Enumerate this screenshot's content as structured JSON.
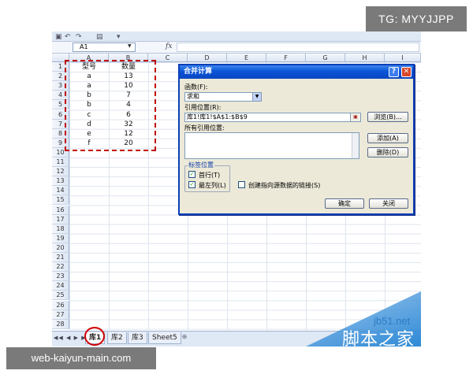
{
  "overlays": {
    "tg": "TG: MYYJJPP",
    "web": "web-kaiyun-main.com"
  },
  "excel": {
    "name_box": "A1",
    "fx": "fx",
    "columns": [
      "A",
      "B",
      "C",
      "D",
      "E",
      "F",
      "G",
      "H",
      "I"
    ],
    "rows": [
      "1",
      "2",
      "3",
      "4",
      "5",
      "6",
      "7",
      "8",
      "9",
      "10",
      "11",
      "12",
      "13",
      "14",
      "15",
      "16",
      "17",
      "18",
      "19",
      "20",
      "21",
      "22",
      "23",
      "24",
      "25",
      "26",
      "27",
      "28"
    ],
    "data": [
      [
        "型号",
        "数量"
      ],
      [
        "a",
        "13"
      ],
      [
        "a",
        "10"
      ],
      [
        "b",
        "7"
      ],
      [
        "b",
        "4"
      ],
      [
        "c",
        "6"
      ],
      [
        "d",
        "32"
      ],
      [
        "e",
        "12"
      ],
      [
        "f",
        "20"
      ]
    ],
    "sheet_tabs": [
      "库1",
      "库2",
      "库3",
      "Sheet5"
    ],
    "active_tab": "库1",
    "tab_nav": "◀◀ ◀ ▶ ▶▶"
  },
  "dialog": {
    "title": "合并计算",
    "help": "?",
    "close": "✕",
    "function_label": "函数(F):",
    "function_value": "求和",
    "reference_label": "引用位置(R):",
    "reference_value": "库1!库1!$A$1:$B$9",
    "browse_button": "浏览(B)...",
    "all_refs_label": "所有引用位置:",
    "add_button": "添加(A)",
    "delete_button": "删除(D)",
    "label_group": "标签位置",
    "top_row_label": "首行(T)",
    "left_col_label": "最左列(L)",
    "link_label": "创建指向源数据的链接(S)",
    "top_row_checked": true,
    "left_col_checked": true,
    "link_checked": false,
    "ok_button": "确定",
    "close_button": "关闭"
  },
  "watermark": {
    "url": "jb51.net",
    "name": "脚本之家"
  }
}
